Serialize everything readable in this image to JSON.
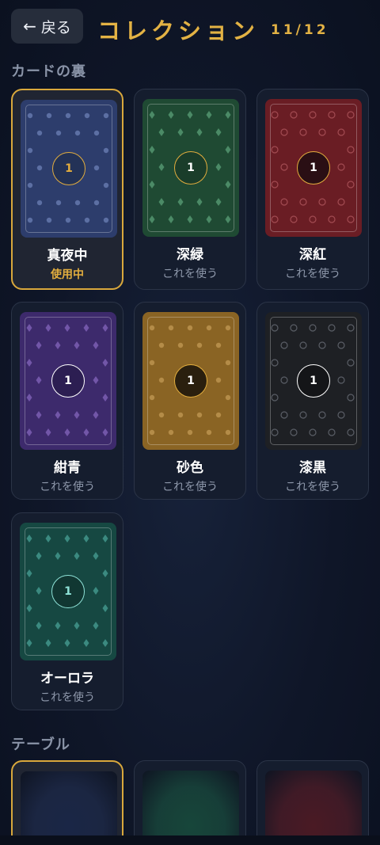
{
  "header": {
    "back_label": "戻る",
    "back_icon": "←",
    "title": "コレクション",
    "counter": "11/12"
  },
  "sections": {
    "card_back": "カードの裏",
    "table": "テーブル"
  },
  "card_backs": [
    {
      "name": "真夜中",
      "status": "使用中",
      "selected": true,
      "pattern": "dot",
      "number": "1",
      "colors": {
        "bg": "#2d3d6c",
        "motif": "#5c6fa3",
        "medal_bg": "#233257",
        "medal_ring": "#e2ad3e",
        "medal_text": "#e2ad3e"
      }
    },
    {
      "name": "深緑",
      "status": "これを使う",
      "selected": false,
      "pattern": "diamond",
      "number": "1",
      "colors": {
        "bg": "#1f4a33",
        "motif": "#4b8a66",
        "medal_bg": "#1a3d2a",
        "medal_ring": "#e2ad3e",
        "medal_text": "#ffffff"
      }
    },
    {
      "name": "深紅",
      "status": "これを使う",
      "selected": false,
      "pattern": "ring",
      "number": "1",
      "colors": {
        "bg": "#6a1d24",
        "motif": "#a24b52",
        "medal_bg": "#2a0f14",
        "medal_ring": "#e2ad3e",
        "medal_text": "#ffffff"
      }
    },
    {
      "name": "紺青",
      "status": "これを使う",
      "selected": false,
      "pattern": "diamond",
      "number": "1",
      "colors": {
        "bg": "#3d2a6c",
        "motif": "#7256a8",
        "medal_bg": "#2c1e52",
        "medal_ring": "#ffffff",
        "medal_text": "#ffffff"
      }
    },
    {
      "name": "砂色",
      "status": "これを使う",
      "selected": false,
      "pattern": "dot",
      "number": "1",
      "colors": {
        "bg": "#8a6424",
        "motif": "#b48c48",
        "medal_bg": "#2a1f0e",
        "medal_ring": "#e2ad3e",
        "medal_text": "#ffffff"
      }
    },
    {
      "name": "漆黒",
      "status": "これを使う",
      "selected": false,
      "pattern": "ring",
      "number": "1",
      "colors": {
        "bg": "#1e2024",
        "motif": "#5a5e66",
        "medal_bg": "#141518",
        "medal_ring": "#ffffff",
        "medal_text": "#ffffff"
      }
    },
    {
      "name": "オーロラ",
      "status": "これを使う",
      "selected": false,
      "pattern": "diamond",
      "number": "1",
      "colors": {
        "bg": "#164842",
        "motif": "#3b8a80",
        "medal_bg": "#113732",
        "medal_ring": "#8fe3d8",
        "medal_text": "#8fe3d8"
      }
    }
  ],
  "tables": [
    {
      "selected": true,
      "color": "#1a2646"
    },
    {
      "selected": false,
      "color": "#17463a"
    },
    {
      "selected": false,
      "color": "#4a1a24"
    }
  ]
}
